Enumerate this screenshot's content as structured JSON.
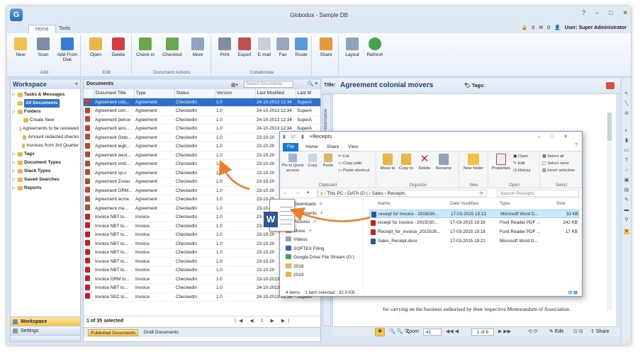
{
  "app": {
    "title": "Globodox - Sample DB",
    "logo_letter": "G"
  },
  "ribbon_tabs": [
    "Home",
    "Tools"
  ],
  "user": {
    "count1": "0",
    "count2": "0",
    "label": "User: Super Administrator"
  },
  "ribbon": {
    "groups": [
      {
        "name": "Add",
        "buttons": [
          "New",
          "Scan",
          "Add From Disk"
        ]
      },
      {
        "name": "Edit",
        "buttons": [
          "Open",
          "Delete"
        ]
      },
      {
        "name": "Document Actions",
        "buttons": [
          "Check-in",
          "Checkout",
          "More"
        ]
      },
      {
        "name": "Collaborate",
        "buttons": [
          "Print",
          "Export",
          "E-mail",
          "Fax",
          "Route"
        ]
      },
      {
        "name": "",
        "buttons": [
          "Share"
        ]
      },
      {
        "name": "",
        "buttons": [
          "Layout",
          "Refresh"
        ]
      }
    ]
  },
  "workspace": {
    "title": "Workspace",
    "tree": [
      {
        "label": "Tasks & Messages",
        "bold": true,
        "level": 0
      },
      {
        "label": "All Documents",
        "bold": true,
        "level": 0,
        "selected": true
      },
      {
        "label": "Folders",
        "bold": true,
        "level": 0
      },
      {
        "label": "Create New",
        "bold": false,
        "level": 1
      },
      {
        "label": "Agreements to be reviewed",
        "bold": false,
        "level": 1
      },
      {
        "label": "Amount redacted checks",
        "bold": false,
        "level": 1
      },
      {
        "label": "Invoices from 3rd Quarter",
        "bold": false,
        "level": 1
      },
      {
        "label": "Tags",
        "bold": true,
        "level": 0
      },
      {
        "label": "Document Types",
        "bold": true,
        "level": 0
      },
      {
        "label": "Stack Types",
        "bold": true,
        "level": 0
      },
      {
        "label": "Saved Searches",
        "bold": true,
        "level": 0
      },
      {
        "label": "Reports",
        "bold": true,
        "level": 0
      }
    ],
    "footer": [
      "Workspace",
      "Settings"
    ]
  },
  "documents": {
    "title": "Documents",
    "search_placeholder": "Search Documents",
    "columns": [
      "Document Title",
      "Type",
      "Status",
      "Version",
      "Last Modified",
      "Last M"
    ],
    "rows": [
      {
        "icon": "word",
        "title": "Agreement colo...",
        "type": "Agreement",
        "status": "CheckedIn",
        "version": "1.0",
        "modified": "24-10-2013 12:34",
        "by": "SuperA"
      },
      {
        "icon": "word",
        "title": "Agreement corr...",
        "type": "Agreement",
        "status": "CheckedIn",
        "version": "1.0",
        "modified": "24-10-2013 12:34",
        "by": "SuperA"
      },
      {
        "icon": "word",
        "title": "Agreement petrox",
        "type": "Agreement",
        "status": "CheckedIn",
        "version": "1.0",
        "modified": "24-10-2013 12:34",
        "by": "SuperA"
      },
      {
        "icon": "word",
        "title": "Agreement axis...",
        "type": "Agreement",
        "status": "CheckedIn",
        "version": "1.0",
        "modified": "24-10-2013 12:34",
        "by": "SuperA"
      },
      {
        "icon": "word",
        "title": "Agreement Glob...",
        "type": "Agreement",
        "status": "CheckedIn",
        "version": "1.0",
        "modified": "23-10-20",
        "by": ""
      },
      {
        "icon": "word",
        "title": "Agreement legit...",
        "type": "Agreement",
        "status": "CheckedIn",
        "version": "1.0",
        "modified": "23-10-20",
        "by": ""
      },
      {
        "icon": "word",
        "title": "Agreement west...",
        "type": "Agreement",
        "status": "CheckedIn",
        "version": "1.0",
        "modified": "23-10-20",
        "by": ""
      },
      {
        "icon": "word",
        "title": "Agreement smit...",
        "type": "Agreement",
        "status": "CheckedIn",
        "version": "1.0",
        "modified": "23-10-20",
        "by": ""
      },
      {
        "icon": "word",
        "title": "Agreement sp-c",
        "type": "Agreement",
        "status": "CheckedIn",
        "version": "1.0",
        "modified": "23-10-20",
        "by": ""
      },
      {
        "icon": "word",
        "title": "Agreement Zuvas",
        "type": "Agreement",
        "status": "CheckedIn",
        "version": "1.0",
        "modified": "23-10-20",
        "by": ""
      },
      {
        "icon": "word",
        "title": "Agreement ORM...",
        "type": "Agreement",
        "status": "CheckedIn",
        "version": "1.0",
        "modified": "23-10-20",
        "by": ""
      },
      {
        "icon": "word",
        "title": "Agreement acme",
        "type": "Agreement",
        "status": "CheckedIn",
        "version": "1.0",
        "modified": "23-10-20",
        "by": ""
      },
      {
        "icon": "word",
        "title": "Agreement ma...",
        "type": "Agreement",
        "status": "CheckedIn",
        "version": "1.0",
        "modified": "23-10-20",
        "by": ""
      },
      {
        "icon": "pdf",
        "title": "Invoice NBT to...",
        "type": "Invoice",
        "status": "CheckedIn",
        "version": "1.0",
        "modified": "23-10-20",
        "by": ""
      },
      {
        "icon": "pdf",
        "title": "Invoice NBT to...",
        "type": "Invoice",
        "status": "CheckedIn",
        "version": "1.0",
        "modified": "23-10-20",
        "by": ""
      },
      {
        "icon": "pdf",
        "title": "Invoice NBT to...",
        "type": "Invoice",
        "status": "CheckedIn",
        "version": "1.0",
        "modified": "23-10-20",
        "by": ""
      },
      {
        "icon": "pdf",
        "title": "Invoice NBT to...",
        "type": "Invoice",
        "status": "CheckedIn",
        "version": "1.0",
        "modified": "23-10-20",
        "by": ""
      },
      {
        "icon": "pdf",
        "title": "Invoice NBT to...",
        "type": "Invoice",
        "status": "CheckedIn",
        "version": "1.0",
        "modified": "23-10-20",
        "by": ""
      },
      {
        "icon": "pdf",
        "title": "Invoice NBT to...",
        "type": "Invoice",
        "status": "CheckedIn",
        "version": "1.0",
        "modified": "23-10-20",
        "by": ""
      },
      {
        "icon": "pdf",
        "title": "Invoice NBT to...",
        "type": "Invoice",
        "status": "CheckedIn",
        "version": "1.0",
        "modified": "23-10-20",
        "by": ""
      },
      {
        "icon": "pdf",
        "title": "Invoice ORM to...",
        "type": "Invoice",
        "status": "CheckedIn",
        "version": "1.0",
        "modified": "23-10-2013 12:34",
        "by": "SuperA"
      },
      {
        "icon": "pdf",
        "title": "Invoice NBT to...",
        "type": "Invoice",
        "status": "CheckedIn",
        "version": "1.0",
        "modified": "24-10-2013 12:34",
        "by": "SuperA"
      },
      {
        "icon": "pdf",
        "title": "Invoice SEC to...",
        "type": "Invoice",
        "status": "CheckedIn",
        "version": "1.0",
        "modified": "24-10-2013 12:34",
        "by": "SuperA"
      }
    ],
    "status": "1 of 35 selected",
    "pager": "1",
    "tabs": [
      "Published Documents",
      "Draft Documents"
    ]
  },
  "preview": {
    "title_label": "Title:",
    "title": "Agreement colonial movers",
    "tags_label": "Tags:",
    "info_label": "Information",
    "body_text": "for carrying on the business authorised by their respective Memorandum of Association.",
    "zoom_label": "Zoom",
    "zoom_value": "41",
    "page": "1 of 6",
    "edit_label": "Edit",
    "share_label": "Share"
  },
  "explorer": {
    "title": "Receipts",
    "tabs": [
      "File",
      "Home",
      "Share",
      "View"
    ],
    "groups": {
      "clipboard": {
        "name": "Clipboard",
        "pin": "Pin to Quick access",
        "copy": "Copy",
        "paste": "Paste",
        "cut": "Cut",
        "copy_path": "Copy path",
        "paste_shortcut": "Paste shortcut"
      },
      "organize": {
        "name": "Organize",
        "move": "Move to",
        "copy": "Copy to",
        "delete": "Delete",
        "rename": "Rename"
      },
      "new": {
        "name": "New",
        "new_folder": "New folder"
      },
      "open": {
        "name": "Open",
        "properties": "Properties",
        "open": "Open",
        "edit": "Edit",
        "history": "History"
      },
      "select": {
        "name": "Select",
        "all": "Select all",
        "none": "Select none",
        "invert": "Invert selection"
      }
    },
    "path": [
      "This PC",
      "DATA (D:)",
      "Sales",
      "Receipts"
    ],
    "search_placeholder": "Search Receipts",
    "nav": [
      "Downloads",
      "Documents",
      "Pictures",
      "Music",
      "Videos",
      "SOFTEX Filing",
      "Google Drive File Stream (G:)",
      "2018",
      "2019"
    ],
    "columns": [
      "Name",
      "Date modified",
      "Type",
      "Size"
    ],
    "files": [
      {
        "name": "receipt for Invoice - 2015030...",
        "date": "17-03-2015 19:13",
        "type": "Microsoft Word D...",
        "size": "33 KB",
        "icon": "word",
        "selected": true
      },
      {
        "name": "receipt for Invoice - 2015030...",
        "date": "17-03-2015 19:16",
        "type": "Foxit Reader PDF ...",
        "size": "242 KB",
        "icon": "pdf",
        "selected": false
      },
      {
        "name": "Receipt_for_invoice_2015030...",
        "date": "17-03-2015 19:18",
        "type": "Foxit Reader PDF ...",
        "size": "17 KB",
        "icon": "pdf",
        "selected": false
      },
      {
        "name": "Sales_Receipt.docx",
        "date": "17-03-2015 19:21",
        "type": "Microsoft Word D...",
        "size": "",
        "icon": "word",
        "selected": false
      }
    ],
    "status": [
      "4 items",
      "1 item selected",
      "32.0 KB"
    ]
  },
  "drag": {
    "badge": "W"
  },
  "colors": {
    "accent": "#2f6fc9",
    "arrow": "#f07a28",
    "explorer_file_tab": "#1979ca"
  }
}
